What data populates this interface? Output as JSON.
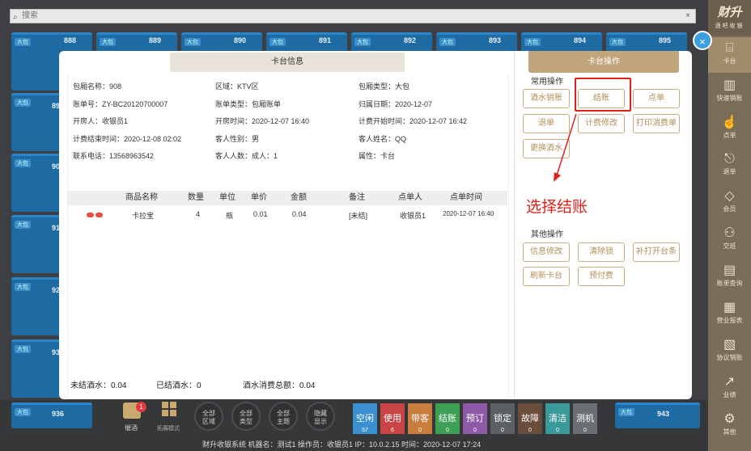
{
  "search": {
    "placeholder": "搜索",
    "clear": "×"
  },
  "rooms": {
    "tag": "大包",
    "n888": "888",
    "n889": "889",
    "n890": "890",
    "n891": "891",
    "n892": "892",
    "n893": "893",
    "n894": "894",
    "n895": "895",
    "n936": "936",
    "n943": "943",
    "p89": "89",
    "p90": "90",
    "p91": "91",
    "p92": "92",
    "p93": "93"
  },
  "brand": {
    "logo": "财升",
    "sub": "酒吧收银"
  },
  "sidebar": {
    "items": [
      {
        "label": "卡台",
        "icon": "⌸"
      },
      {
        "label": "快速销账",
        "icon": "▥"
      },
      {
        "label": "点单",
        "icon": "☝"
      },
      {
        "label": "退单",
        "icon": "⎋"
      },
      {
        "label": "会员",
        "icon": "◇"
      },
      {
        "label": "交班",
        "icon": "⚇"
      },
      {
        "label": "账单查询",
        "icon": "▤"
      },
      {
        "label": "营业报表",
        "icon": "▦"
      },
      {
        "label": "协议销账",
        "icon": "▧"
      },
      {
        "label": "业绩",
        "icon": "↗"
      },
      {
        "label": "其他",
        "icon": "⚙"
      }
    ]
  },
  "bottom": {
    "call_label": "催酒",
    "call_badge": "1",
    "mode_label": "拓展模式",
    "circles": [
      {
        "label": "全部\n区域"
      },
      {
        "label": "全部\n类型"
      },
      {
        "label": "全部\n主题"
      },
      {
        "label": "隐藏\n显示"
      }
    ],
    "tiles": [
      {
        "label": "空闲",
        "count": "57",
        "color": "#3a8fd0"
      },
      {
        "label": "使用",
        "count": "6",
        "color": "#c94545"
      },
      {
        "label": "带客",
        "count": "0",
        "color": "#c97d3e"
      },
      {
        "label": "结账",
        "count": "0",
        "color": "#3e9f55"
      },
      {
        "label": "预订",
        "count": "0",
        "color": "#8e5aa8"
      },
      {
        "label": "锁定",
        "count": "0",
        "color": "#5c5f63"
      },
      {
        "label": "故障",
        "count": "0",
        "color": "#6a4e3b"
      },
      {
        "label": "清洁",
        "count": "0",
        "color": "#3a9a9a"
      },
      {
        "label": "测机",
        "count": "0",
        "color": "#6b6f74"
      }
    ],
    "status": "财升收银系统        机器名：测试1    操作员：收银员1    IP：10.0.2.15    时间：2020-12-07 17:24"
  },
  "modal": {
    "left_title": "卡台信息",
    "info": {
      "room_name": "包厢名称：908",
      "area": "区域：KTV区",
      "room_type": "包厢类型：大包",
      "bill_no": "账单号：ZY-BC20120700007",
      "bill_type": "账单类型：包厢账单",
      "belong_date": "归属日期：2020-12-07",
      "opener": "开房人：收银员1",
      "open_time": "开房时间：2020-12-07 16:40",
      "bill_start": "计费开始时间：2020-12-07 16:42",
      "bill_end": "计费结束时间：2020-12-08 02:02",
      "guest_sex": "客人性别：男",
      "guest_name": "客人姓名：QQ",
      "phone": "联系电话：13568963542",
      "guest_count": "客人人数：成人：1",
      "attr": "属性：卡台"
    },
    "table": {
      "headers": [
        "商品名称",
        "数量",
        "单位",
        "单价",
        "金额",
        "备注",
        "点单人",
        "点单时间"
      ],
      "rows": [
        [
          "卡拉宝",
          "4",
          "瓶",
          "0.01",
          "0.04",
          "[未结]",
          "收银员1",
          "2020-12-07 16:40"
        ]
      ]
    },
    "footer": {
      "unsettled": "未结酒水：0.04",
      "settled": "已结酒水：0",
      "total": "酒水消费总额：0.04"
    },
    "right_title": "卡台操作",
    "common_title": "常用操作",
    "common": [
      "酒水销账",
      "结账",
      "点单",
      "退单",
      "计费修改",
      "打印消费单",
      "更换酒水"
    ],
    "other_title": "其他操作",
    "other": [
      "信息修改",
      "清除锁",
      "补打开台条",
      "刷新卡台",
      "预付费"
    ],
    "annotation": "选择结账",
    "close": "×"
  },
  "colors": {
    "accent": "#c1a57b",
    "highlight": "#e0201a",
    "room": "#1e6aa3"
  }
}
